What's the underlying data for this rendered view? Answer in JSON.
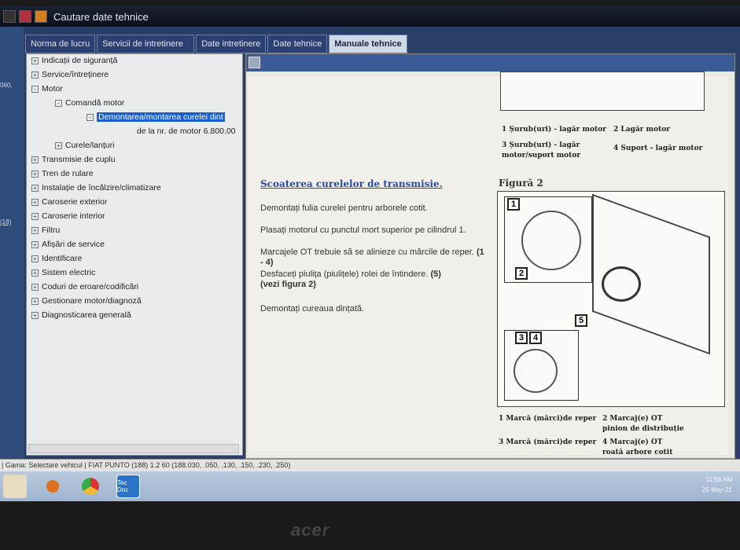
{
  "window": {
    "title": "Cautare date tehnice"
  },
  "left_strip": {
    "a": "060,",
    "b": "(18)"
  },
  "tabs": [
    "Norma de lucru",
    "Servicii de intretinere",
    "Date intretinere",
    "Date tehnice",
    "Manuale tehnice"
  ],
  "tree": [
    {
      "label": "Indicații de siguranță",
      "sign": "+"
    },
    {
      "label": "Service/întreținere",
      "sign": "+"
    },
    {
      "label": "Motor",
      "sign": "-"
    },
    {
      "label": "Comandă motor",
      "sign": "-"
    },
    {
      "label": "Demontarea/montarea curelei dint",
      "sign": "-"
    },
    {
      "label": "de la nr. de motor 6.800.00",
      "sign": ""
    },
    {
      "label": "Curele/lanțuri",
      "sign": "+"
    },
    {
      "label": "Transmisie de cuplu",
      "sign": "+"
    },
    {
      "label": "Tren de rulare",
      "sign": "+"
    },
    {
      "label": "Instalație de încălzire/climatizare",
      "sign": "+"
    },
    {
      "label": "Caroserie exterior",
      "sign": "+"
    },
    {
      "label": "Caroserie interior",
      "sign": "+"
    },
    {
      "label": "Filtru",
      "sign": "+"
    },
    {
      "label": "Afișări de service",
      "sign": "+"
    },
    {
      "label": "Identificare",
      "sign": "+"
    },
    {
      "label": "Sistem electric",
      "sign": "+"
    },
    {
      "label": "Coduri de eroare/codificări",
      "sign": "+"
    },
    {
      "label": "Gestionare motor/diagnoză",
      "sign": "+"
    },
    {
      "label": "Diagnosticarea generală",
      "sign": "+"
    }
  ],
  "doc": {
    "heading": "Scoaterea curelelor de transmisie.",
    "p1": "Demontați fulia curelei pentru arborele cotit.",
    "p2": "Plasați motorul cu punctul mort superior pe cilindrul 1.",
    "p3": "Marcajele OT trebuie să se alinieze cu mărcile de reper.",
    "p3b": "(1 - 4)",
    "p4": "Desfaceți piulița (piulițele) rolei de întindere.",
    "p4b": "(5)",
    "p4c": "(vezi figura 2)",
    "p5": "Demontați cureaua dințată.",
    "fig1_legend": [
      "1 Șurub(uri) - lagăr motor",
      "2 Lagăr motor",
      "3 Șurub(uri) - lagăr motor/suport motor",
      "4 Suport - lagăr motor"
    ],
    "fig2_title": "Figură 2",
    "fig2_labels": [
      "1",
      "2",
      "3",
      "4",
      "5"
    ],
    "fig2_legend": [
      "1 Marcă (mărci)de reper",
      "2 Marcaj(e) OT pinion de distribuție",
      "3 Marcă (mărci)de reper",
      "4 Marcaj(e) OT roată arbore cotit"
    ]
  },
  "status": "| Gama: Selectare vehicul | FIAT PUNTO (188) 1.2 60 (188.030, .050, .130, .150, .230, .250)",
  "taskbar": {
    "tecdoc": "Tec Doc",
    "time": "11:56 AM",
    "date": "25-May-21"
  },
  "bezel_logo": "acer"
}
